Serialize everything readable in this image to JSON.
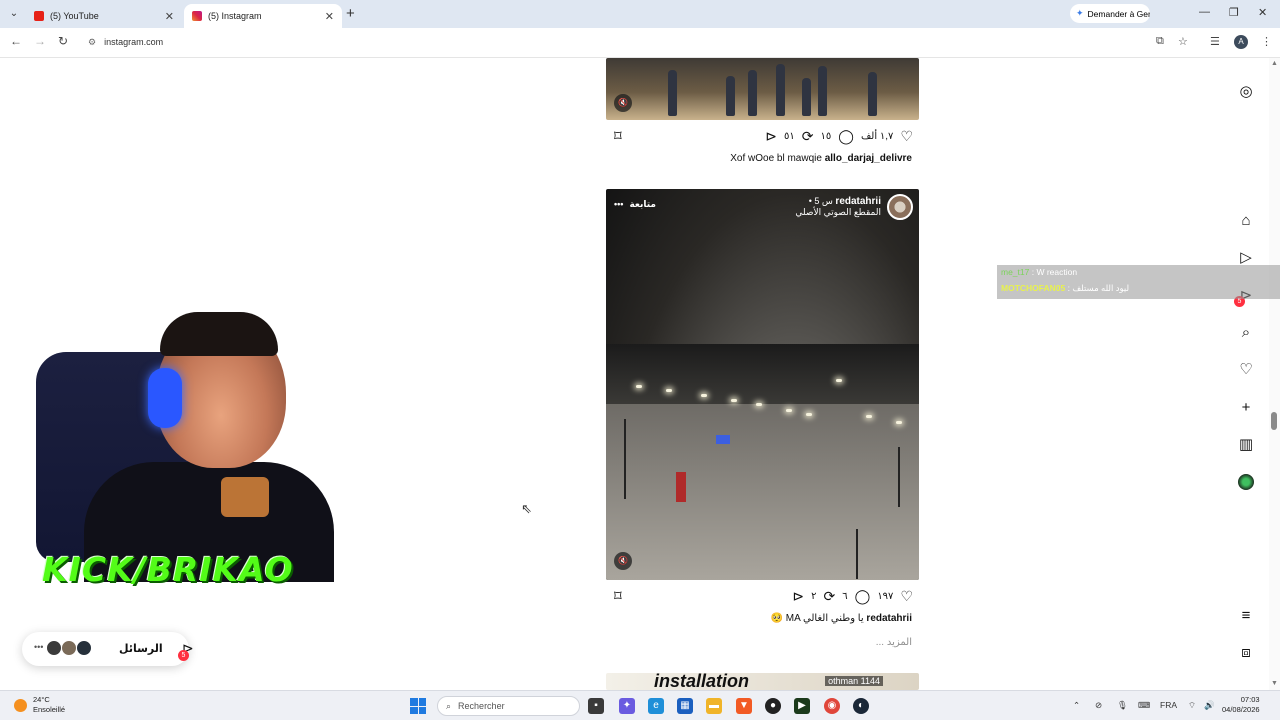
{
  "browser": {
    "tabs": [
      {
        "label": "(5) YouTube"
      },
      {
        "label": "(5) Instagram"
      }
    ],
    "gemini_label": "Demander à Gemini",
    "url": "instagram.com",
    "profile_initial": "A"
  },
  "post1": {
    "likes": "١,٧ ألف",
    "comments": "١٥",
    "reposts": "٥١",
    "caption_user": "allo_darjaj_delivre",
    "caption_text": "Xof wOoe bl mawqie"
  },
  "post2": {
    "username": "redatahrii",
    "time": "• 5 س",
    "audio": "المقطع الصوتي الأصلي",
    "follow_label": "متابعة",
    "menu": "•••",
    "likes": "١٩٧",
    "comments": "٦",
    "reposts": "٢",
    "caption_user": "redatahrii",
    "caption_text": "🥺 MA يا وطني الغالي",
    "more_label": "... المزيد"
  },
  "post3": {
    "overlay_text": "installation",
    "user_tag": "othman 1144"
  },
  "sidebar": {
    "notifications_badge": "5"
  },
  "chat": {
    "line1_user": "me_t17",
    "line1_text": ": W reaction",
    "line2_user": "MOTCHOFAN05",
    "line2_text": ": ليود الله مستلف"
  },
  "webcam": {
    "overlay_text": "KICK/BRIKAO"
  },
  "messages": {
    "label": "الرسائل",
    "badge": "5",
    "dots": "•••"
  },
  "taskbar": {
    "temperature": "24°C",
    "weather": "Ensoleillé",
    "search_placeholder": "Rechercher",
    "lang": "FRA",
    "time": "07:03",
    "date": "04/08/2026"
  },
  "colors": {
    "accent_red": "#ff3040",
    "kick_green": "#53fc18",
    "tab_strip": "#dfe7f2"
  }
}
